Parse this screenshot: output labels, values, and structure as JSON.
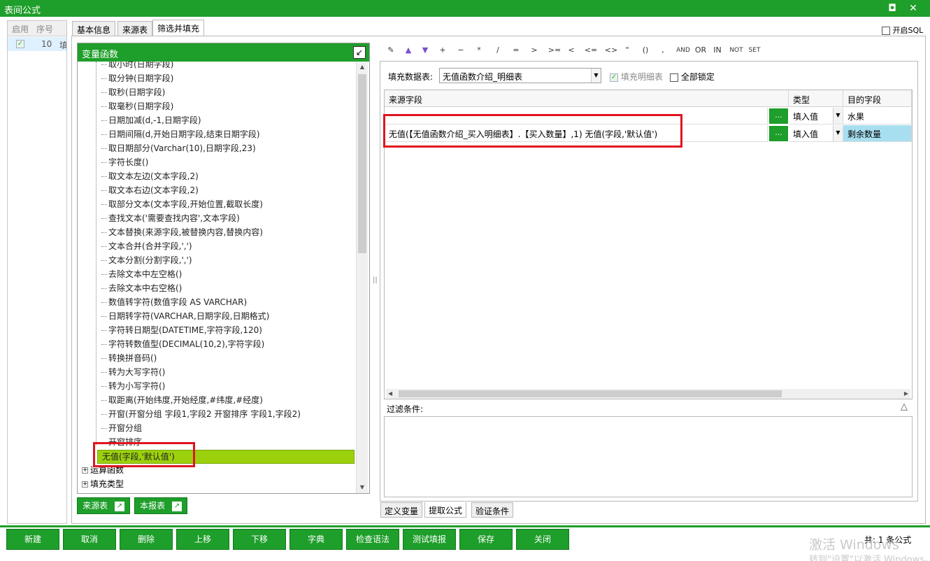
{
  "window": {
    "title": "表间公式",
    "restore_label": "◘",
    "close_label": "✕"
  },
  "left_list": {
    "col_enabled": "启用",
    "col_no": "序号",
    "row_no": "10",
    "row_trail": "填"
  },
  "tabs": [
    "基本信息",
    "来源表",
    "筛选并填充"
  ],
  "open_sql_label": "开启SQL",
  "var_panel": {
    "title": "变量函数",
    "collapse_icon": "↙",
    "items": [
      "取小时(日期字段)",
      "取分钟(日期字段)",
      "取秒(日期字段)",
      "取毫秒(日期字段)",
      "日期加减(d,-1,日期字段)",
      "日期间隔(d,开始日期字段,结束日期字段)",
      "取日期部分(Varchar(10),日期字段,23)",
      "字符长度()",
      "取文本左边(文本字段,2)",
      "取文本右边(文本字段,2)",
      "取部分文本(文本字段,开始位置,截取长度)",
      "查找文本('需要查找内容',文本字段)",
      "文本替换(来源字段,被替换内容,替换内容)",
      "文本合并(合并字段,',')",
      "文本分割(分割字段,',')",
      "去除文本中左空格()",
      "去除文本中右空格()",
      "数值转字符(数值字段 AS VARCHAR)",
      "日期转字符(VARCHAR,日期字段,日期格式)",
      "字符转日期型(DATETIME,字符字段,120)",
      "字符转数值型(DECIMAL(10,2),字符字段)",
      "转换拼音码()",
      "转为大写字符()",
      "转为小写字符()",
      "取距离(开始纬度,开始经度,#纬度,#经度)",
      "开窗(开窗分组 字段1,字段2 开窗排序 字段1,字段2)",
      "开窗分组",
      "开窗排序",
      "无值(字段,'默认值')"
    ],
    "groups": [
      "运算函数",
      "填充类型"
    ],
    "source_table_btn": "来源表",
    "report_table_btn": "本报表"
  },
  "toolbar": [
    "✎",
    "▲",
    "▼",
    "+",
    "−",
    "*",
    "/",
    "=",
    ">",
    ">=",
    "<",
    "<=",
    "<>",
    "\"",
    "()",
    ",",
    "AND",
    "OR",
    "IN",
    "NOT",
    "SET"
  ],
  "fill": {
    "table_label": "填充数据表:",
    "table_value": "无值函数介绍_明细表",
    "fill_detail_label": "填充明细表",
    "lock_all_label": "全部锁定"
  },
  "grid": {
    "headers": [
      "来源字段",
      "类型",
      "目的字段"
    ],
    "rows": [
      {
        "source": "",
        "btn": "...",
        "type": "填入值",
        "target": "水果"
      },
      {
        "source": "无值(【无值函数介绍_买入明细表】.【买入数量】,1)  无值(字段,'默认值')",
        "btn": "...",
        "type": "填入值",
        "target": "剩余数量"
      }
    ]
  },
  "filter_label": "过滤条件:",
  "bottom_tabs": [
    "定义变量",
    "提取公式",
    "验证条件"
  ],
  "buttons": [
    "新建",
    "取消",
    "删除",
    "上移",
    "下移",
    "字典",
    "检查语法",
    "测试填报",
    "保存",
    "关闭"
  ],
  "status": "共: 1 条公式",
  "watermark": {
    "line1": "激活 Windows",
    "line2": "转到\"设置\"以激活 Windows。"
  },
  "colors": {
    "green": "#1e9e2a",
    "selected_item": "#9bd10c",
    "highlight": "#e0141e"
  }
}
